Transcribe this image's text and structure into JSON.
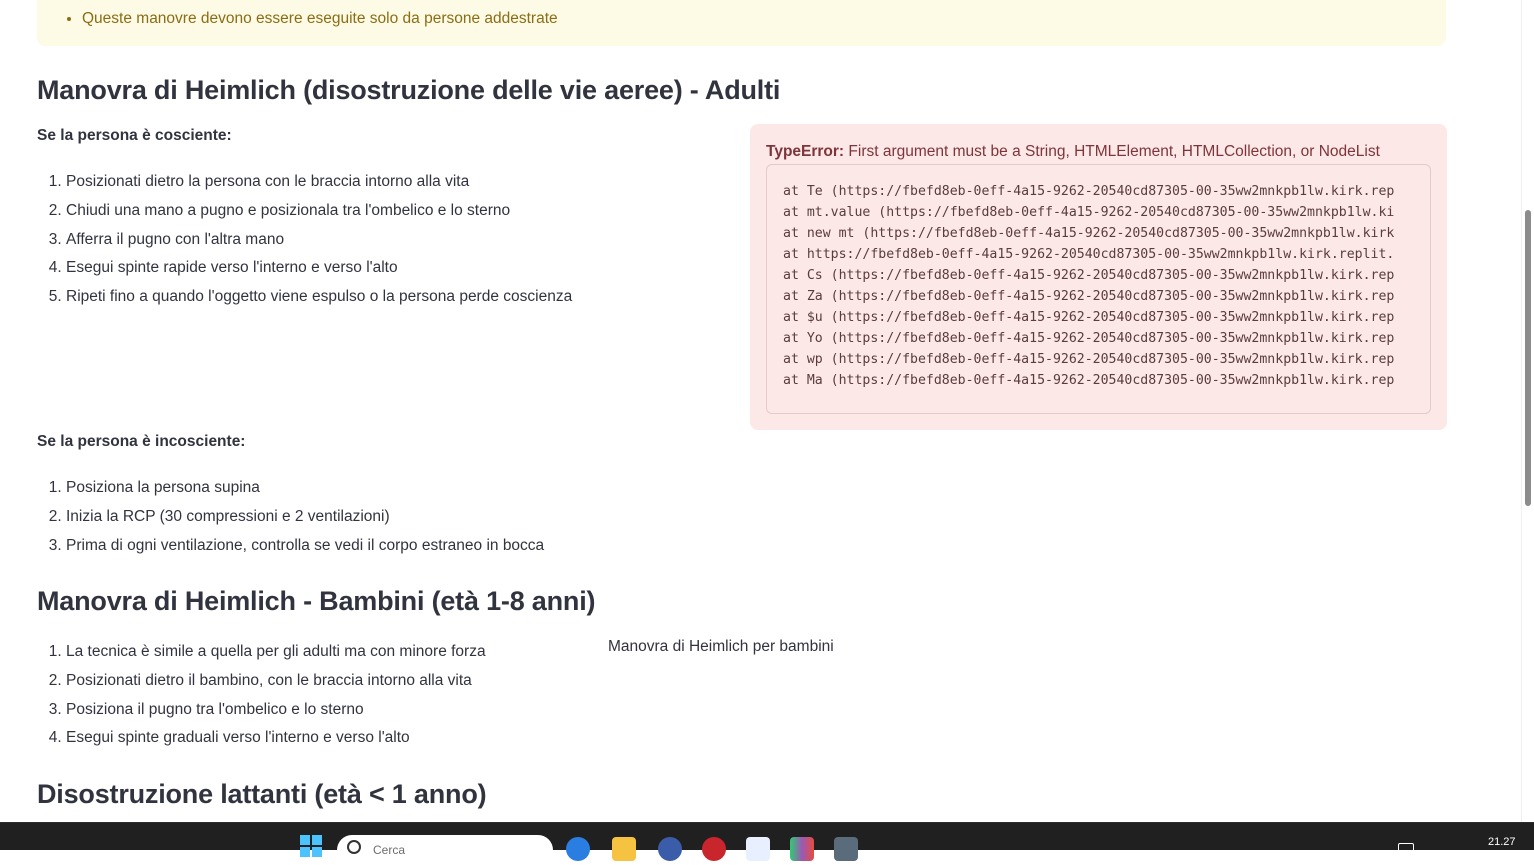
{
  "warning": {
    "last_item": "Queste manovre devono essere eseguite solo da persone addestrate"
  },
  "section_adults": {
    "title": "Manovra di Heimlich (disostruzione delle vie aeree) - Adulti",
    "conscious_label": "Se la persona è cosciente:",
    "conscious_steps": [
      "Posizionati dietro la persona con le braccia intorno alla vita",
      "Chiudi una mano a pugno e posizionala tra l'ombelico e lo sterno",
      "Afferra il pugno con l'altra mano",
      "Esegui spinte rapide verso l'interno e verso l'alto",
      "Ripeti fino a quando l'oggetto viene espulso o la persona perde coscienza"
    ],
    "unconscious_label": "Se la persona è incosciente:",
    "unconscious_steps": [
      "Posiziona la persona supina",
      "Inizia la RCP (30 compressioni e 2 ventilazioni)",
      "Prima di ogni ventilazione, controlla se vedi il corpo estraneo in bocca"
    ]
  },
  "error": {
    "type": "TypeError:",
    "message": "First argument must be a String, HTMLElement, HTMLCollection, or NodeList",
    "stack": [
      "at Te (https://fbefd8eb-0eff-4a15-9262-20540cd87305-00-35ww2mnkpb1lw.kirk.rep",
      "at mt.value (https://fbefd8eb-0eff-4a15-9262-20540cd87305-00-35ww2mnkpb1lw.ki",
      "at new mt (https://fbefd8eb-0eff-4a15-9262-20540cd87305-00-35ww2mnkpb1lw.kirk",
      "at https://fbefd8eb-0eff-4a15-9262-20540cd87305-00-35ww2mnkpb1lw.kirk.replit.",
      "at Cs (https://fbefd8eb-0eff-4a15-9262-20540cd87305-00-35ww2mnkpb1lw.kirk.rep",
      "at Za (https://fbefd8eb-0eff-4a15-9262-20540cd87305-00-35ww2mnkpb1lw.kirk.rep",
      "at $u (https://fbefd8eb-0eff-4a15-9262-20540cd87305-00-35ww2mnkpb1lw.kirk.rep",
      "at Yo (https://fbefd8eb-0eff-4a15-9262-20540cd87305-00-35ww2mnkpb1lw.kirk.rep",
      "at wp (https://fbefd8eb-0eff-4a15-9262-20540cd87305-00-35ww2mnkpb1lw.kirk.rep",
      "at Ma (https://fbefd8eb-0eff-4a15-9262-20540cd87305-00-35ww2mnkpb1lw.kirk.rep"
    ]
  },
  "section_children": {
    "title": "Manovra di Heimlich - Bambini (età 1-8 anni)",
    "steps": [
      "La tecnica è simile a quella per gli adulti ma con minore forza",
      "Posizionati dietro il bambino, con le braccia intorno alla vita",
      "Posiziona il pugno tra l'ombelico e lo sterno",
      "Esegui spinte graduali verso l'interno e verso l'alto"
    ],
    "image_alt": "Manovra di Heimlich per bambini"
  },
  "section_infants": {
    "title": "Disostruzione lattanti (età < 1 anno)"
  },
  "taskbar": {
    "search_placeholder": "Cerca",
    "clock": "21.27"
  },
  "colors": {
    "warning_bg": "#fdfbe5",
    "warning_text": "#8a6d15",
    "error_bg": "#fde8e8",
    "error_text": "#7d353b",
    "text": "#31333f",
    "taskbar_bg": "#202020"
  }
}
